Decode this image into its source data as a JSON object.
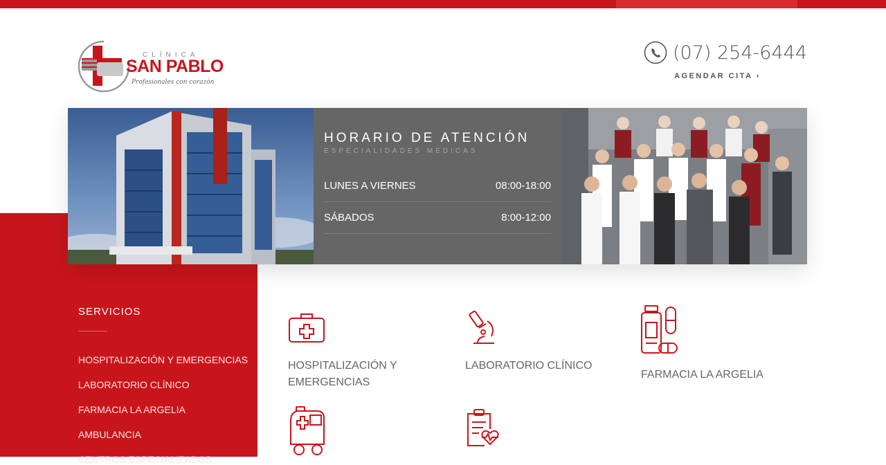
{
  "brand": {
    "logo_top": "CLÍNICA",
    "logo_main": "SAN PABLO",
    "logo_tagline": "Profesionales con corazón",
    "primary_color": "#c8151b",
    "gray_color": "#666666"
  },
  "header": {
    "phone": "(07) 254-6444",
    "phone_icon": "phone-icon",
    "cta_label": "AGENDAR CITA ›"
  },
  "banner": {
    "title": "HORARIO DE ATENCIÓN",
    "subtitle": "ESPECIALIDADES MÉDICAS",
    "rows": [
      {
        "day": "LUNES A VIERNES",
        "time": "08:00-18:00"
      },
      {
        "day": "SÁBADOS",
        "time": "8:00-12:00"
      }
    ]
  },
  "services_nav": {
    "heading": "SERVICIOS",
    "items": [
      "HOSPITALIZACIÓN Y EMERGENCIAS",
      "LABORATORIO CLÍNICO",
      "FARMACIA LA ARGELIA",
      "AMBULANCIA",
      "CENTROS ESPECIALIZADOS"
    ]
  },
  "services_grid": [
    {
      "label_line1": "HOSPITALIZACIÓN Y",
      "label_line2": "EMERGENCIAS",
      "icon": "first-aid-kit-icon"
    },
    {
      "label_line1": "LABORATORIO CLÍNICO",
      "label_line2": "",
      "icon": "microscope-icon"
    },
    {
      "label_line1": "FARMACIA LA ARGELIA",
      "label_line2": "",
      "icon": "pharmacy-icon"
    },
    {
      "label_line1": "",
      "label_line2": "",
      "icon": "ambulance-icon"
    },
    {
      "label_line1": "",
      "label_line2": "",
      "icon": "medical-report-icon"
    }
  ]
}
